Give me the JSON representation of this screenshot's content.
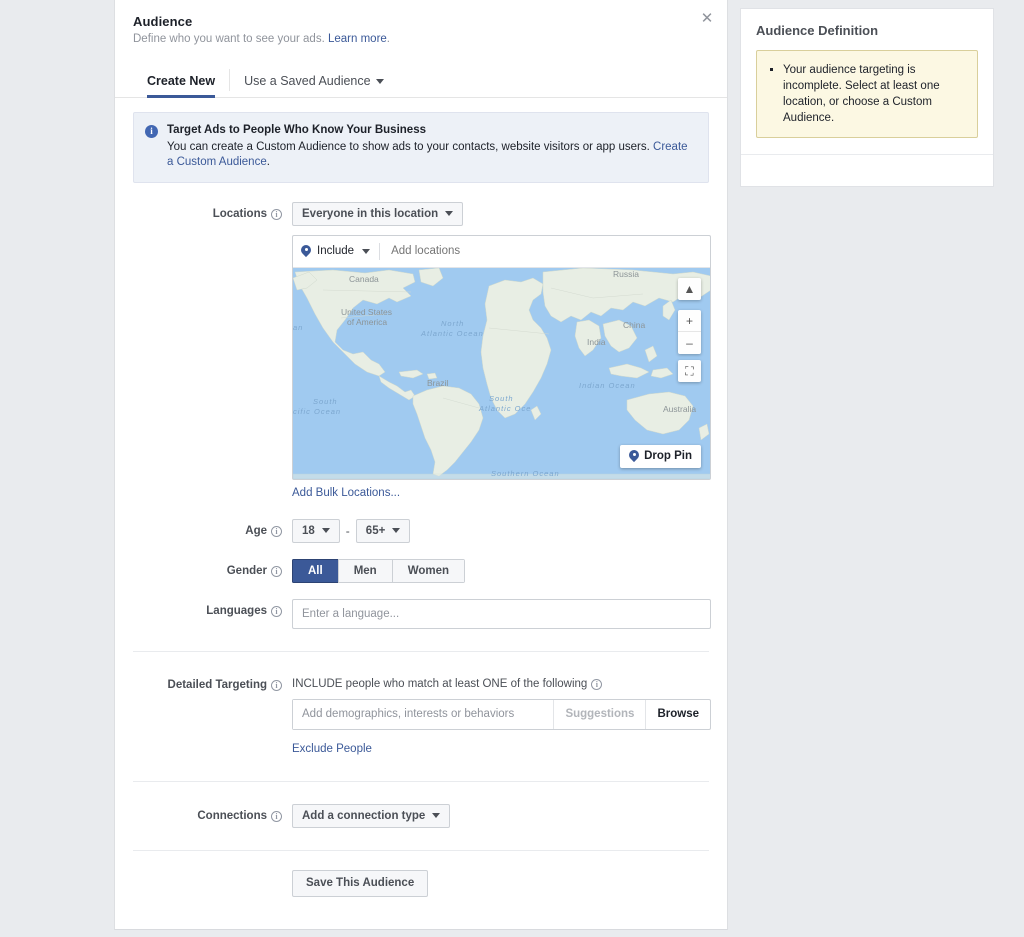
{
  "dialog": {
    "title": "Audience",
    "subtitle": "Define who you want to see your ads.",
    "learn_more": "Learn more",
    "subtitle_period": ".",
    "close_icon": "close-icon"
  },
  "tabs": [
    {
      "label": "Create New",
      "active": true
    },
    {
      "label": "Use a Saved Audience",
      "active": false,
      "has_caret": true
    }
  ],
  "callout": {
    "icon": "i",
    "title": "Target Ads to People Who Know Your Business",
    "text": "You can create a Custom Audience to show ads to your contacts, website visitors or app users. ",
    "link": "Create a Custom Audience",
    "period": "."
  },
  "locations": {
    "label": "Locations",
    "scope_button": "Everyone in this location",
    "include_label": "Include",
    "input_placeholder": "Add locations",
    "bulk_link": "Add Bulk Locations...",
    "drop_pin": "Drop Pin",
    "map_controls": {
      "collapse": "collapse-icon",
      "zoom_in": "+",
      "zoom_out": "–",
      "fullscreen": "fullscreen-icon"
    },
    "map_labels": [
      "Canada",
      "United States",
      "of America",
      "Brazil",
      "Russia",
      "China",
      "India",
      "Australia",
      "North",
      "Atlantic Ocean",
      "South",
      "Atlantic Oce",
      "South",
      "cific Ocean",
      "Indian Ocean",
      "Southern Ocean",
      "an"
    ]
  },
  "age": {
    "label": "Age",
    "min": "18",
    "max": "65+",
    "separator": "-"
  },
  "gender": {
    "label": "Gender",
    "options": [
      {
        "label": "All",
        "selected": true
      },
      {
        "label": "Men",
        "selected": false
      },
      {
        "label": "Women",
        "selected": false
      }
    ]
  },
  "languages": {
    "label": "Languages",
    "placeholder": "Enter a language...",
    "value": ""
  },
  "detailed_targeting": {
    "label": "Detailed Targeting",
    "instruction": "INCLUDE people who match at least ONE of the following",
    "placeholder": "Add demographics, interests or behaviors",
    "value": "",
    "suggestions": "Suggestions",
    "browse": "Browse",
    "exclude_link": "Exclude People"
  },
  "connections": {
    "label": "Connections",
    "button": "Add a connection type"
  },
  "save": {
    "button": "Save This Audience"
  },
  "audience_definition": {
    "title": "Audience Definition",
    "warning": "Your audience targeting is incomplete. Select at least one location, or choose a Custom Audience."
  },
  "colors": {
    "brand": "#3b5998",
    "link": "#3b5998",
    "callout_bg": "#edf1f7",
    "warning_bg": "#fcf8e3",
    "warning_border": "#d9cf9b",
    "page_bg": "#e9ebee",
    "map_water": "#a0caf0",
    "map_land": "#e8eee4"
  }
}
